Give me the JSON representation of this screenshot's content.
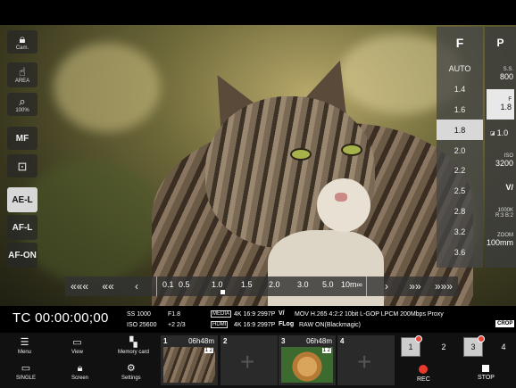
{
  "left_tools": [
    {
      "icon": "lock",
      "label": "Cam."
    },
    {
      "icon": "hand",
      "label": "AREA"
    },
    {
      "icon": "magnifier",
      "label": "100%"
    },
    {
      "label": "MF"
    },
    {
      "icon": "frame"
    },
    {
      "label": "AE-L"
    },
    {
      "label": "AF-L"
    },
    {
      "label": "AF-ON"
    }
  ],
  "f_column": {
    "header": "F",
    "items": [
      "AUTO",
      "1.4",
      "1.6",
      "1.8",
      "2.0",
      "2.2",
      "2.5",
      "2.8",
      "3.2",
      "3.6"
    ],
    "selected": "1.8"
  },
  "p_column": {
    "header": "P",
    "ss_label": "S.S.",
    "ss_value": "800",
    "f_label": "F",
    "f_value": "1.8",
    "ev_value": "1.0",
    "iso_label": "ISO",
    "iso_value": "3200",
    "wb_value": "1000K",
    "wb_sub": "R:3 B:2",
    "zoom_label": "ZOOM",
    "zoom_value": "100mm"
  },
  "focus_bar": {
    "left_arrows": [
      "«««",
      "««",
      "‹"
    ],
    "ticks": [
      "0.1",
      "0.5",
      "1.0",
      "1.5",
      "2.0",
      "3.0",
      "5.0",
      "10m∞"
    ],
    "right_arrows": [
      "›",
      "»»",
      "»»»"
    ]
  },
  "info": {
    "timecode": "TC 00:00:00;00",
    "ss": "SS 1000",
    "iso": "ISO 25600",
    "f": "F1.8",
    "ev": "+2 2/3",
    "media_tag": "MEDIA",
    "hdmi_tag": "HDMI",
    "media_fmt": "4K 16:9 2997P",
    "hdmi_fmt": "4K 16:9 2997P",
    "codec": "MOV H.265 4:2:2 10bit L-GOP LPCM 200Mbps Proxy",
    "flog": "FLog",
    "raw": "RAW ON(Blackmagic)",
    "crop": "CROP"
  },
  "bottom": {
    "menu": "Menu",
    "view": "View",
    "memory": "Memory card",
    "single": "SINGLE",
    "screen": "Screen",
    "settings": "Settings",
    "slots": [
      {
        "num": "1",
        "remaining": "06h48m",
        "kind": "cat",
        "mini": "1 2"
      },
      {
        "num": "2",
        "remaining": "",
        "kind": "empty"
      },
      {
        "num": "3",
        "remaining": "06h48m",
        "kind": "dog",
        "mini": "1 2"
      },
      {
        "num": "4",
        "remaining": "",
        "kind": "empty"
      }
    ],
    "cam_buttons": [
      "1",
      "2",
      "3",
      "4"
    ],
    "rec": "REC",
    "stop": "STOP"
  }
}
